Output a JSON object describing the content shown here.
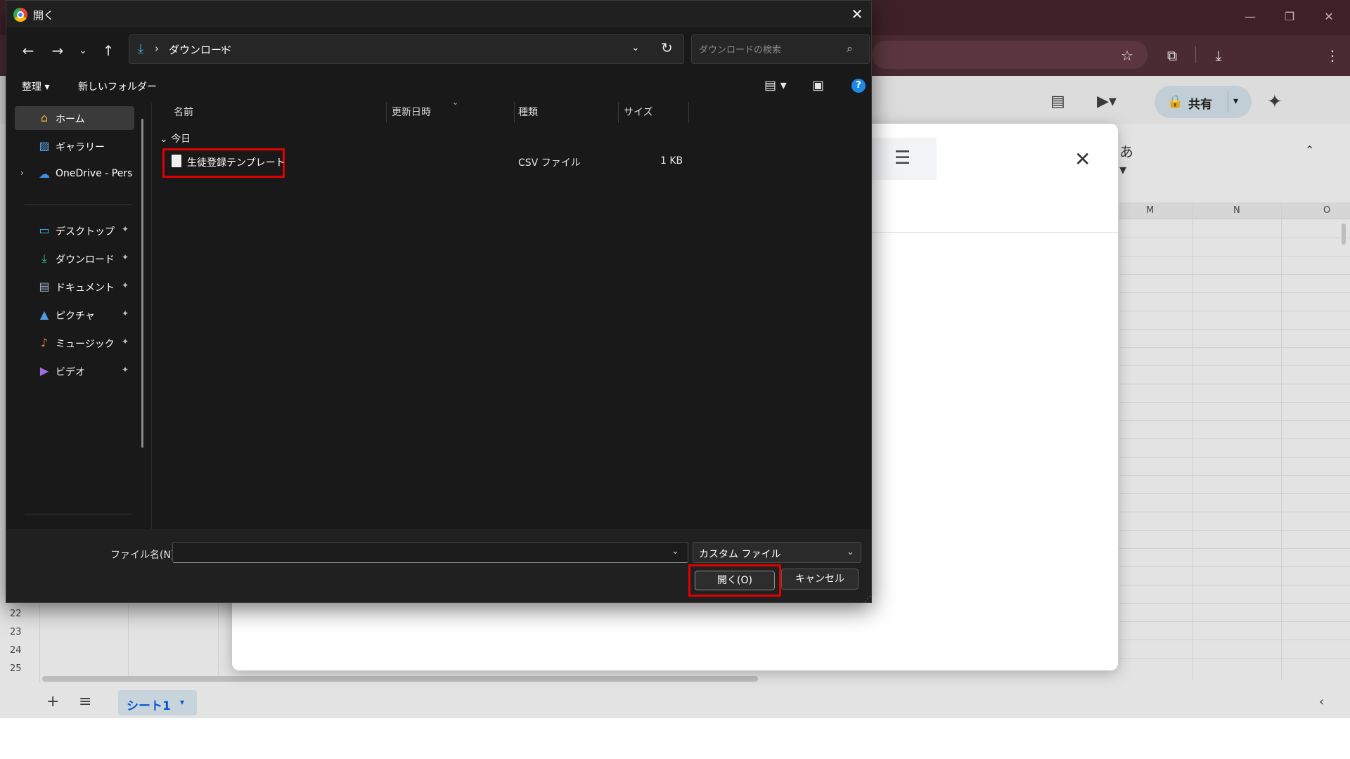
{
  "dialog": {
    "title": "開く",
    "address": {
      "crumb": "ダウンロード",
      "sep": "›"
    },
    "search_placeholder": "ダウンロードの検索",
    "commands": {
      "organize": "整理 ▾",
      "new_folder": "新しいフォルダー"
    },
    "nav_items": [
      {
        "label": "ホーム",
        "icon": "home-icon",
        "selected": true,
        "pinned": false
      },
      {
        "label": "ギャラリー",
        "icon": "gallery-icon",
        "pinned": false
      },
      {
        "label": "OneDrive - Pers",
        "icon": "cloud-icon",
        "pinned": false,
        "expandable": true
      },
      {
        "label": "デスクトップ",
        "icon": "desktop-icon",
        "pinned": true
      },
      {
        "label": "ダウンロード",
        "icon": "download-icon",
        "pinned": true
      },
      {
        "label": "ドキュメント",
        "icon": "document-icon",
        "pinned": true
      },
      {
        "label": "ピクチャ",
        "icon": "picture-icon",
        "pinned": true
      },
      {
        "label": "ミュージック",
        "icon": "music-icon",
        "pinned": true
      },
      {
        "label": "ビデオ",
        "icon": "video-icon",
        "pinned": true
      }
    ],
    "columns": [
      "名前",
      "更新日時",
      "種類",
      "サイズ"
    ],
    "group_label": "今日",
    "files": [
      {
        "name": "生徒登録テンプレート",
        "modified": "",
        "type": "CSV ファイル",
        "size": "1 KB"
      }
    ],
    "footer": {
      "filename_label": "ファイル名(N):",
      "filename_value": "",
      "filetype": "カスタム ファイル",
      "open_label": "開く(O)",
      "cancel_label": "キャンセル"
    }
  },
  "browser": {
    "share_label": "共有",
    "sheet_tab": "シート1",
    "columns": [
      "M",
      "N",
      "O"
    ],
    "row_numbers": [
      "22",
      "23",
      "24",
      "25"
    ],
    "input_mode": "あ"
  },
  "colors": {
    "highlight": "#e00000",
    "dialog_bg": "#191919",
    "browser_frame": "#4a2a33",
    "accent_blue": "#1e88e5"
  }
}
